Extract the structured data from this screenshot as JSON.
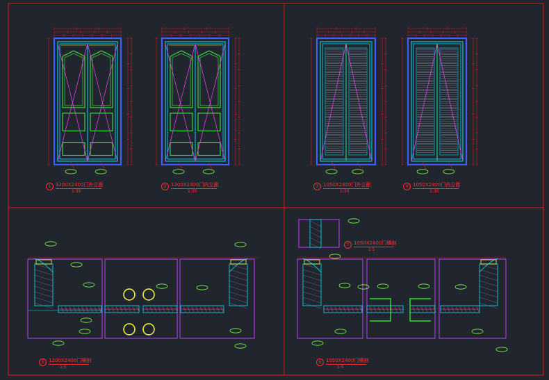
{
  "drawings": [
    {
      "number": "1",
      "title": "1200X2400门外立面",
      "scale": "1:30"
    },
    {
      "number": "2",
      "title": "1200X2400门内立面",
      "scale": "1:30"
    },
    {
      "number": "3",
      "title": "1050X2400门外立面",
      "scale": "1:30"
    },
    {
      "number": "4",
      "title": "1050X2400门内立面",
      "scale": "1:30"
    },
    {
      "number": "5",
      "title": "1200X2400门横剖",
      "scale": "1:5"
    },
    {
      "number": "6",
      "title": "1050X2400门横剖",
      "scale": "1:5"
    },
    {
      "number": "7",
      "title": "1050X2400门横剖",
      "scale": "1:5"
    }
  ],
  "colors": {
    "background": "#21252d",
    "frame": "#e01818",
    "door": "#00e5ff",
    "panel": "#3cff3c",
    "blue": "#4060ff",
    "diagonal": "#ff40ff",
    "yellow": "#ffff40",
    "tag": "#7dff4a"
  }
}
